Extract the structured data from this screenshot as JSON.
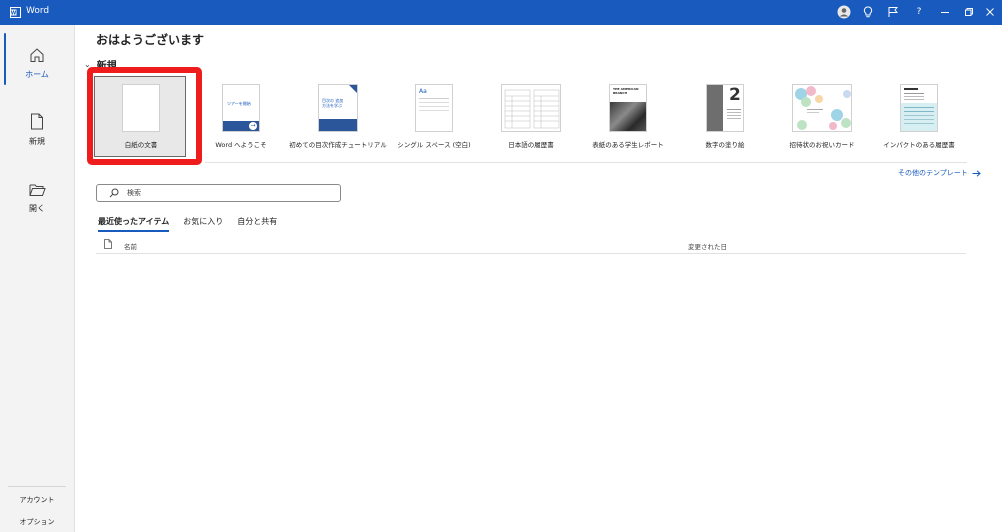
{
  "titlebar": {
    "app_name": "Word",
    "bg_color": "#185abd",
    "controls": [
      "avatar-icon",
      "lightbulb-icon",
      "feedback-icon",
      "help-icon",
      "minimize-icon",
      "restore-icon",
      "close-icon"
    ],
    "help_label": "?"
  },
  "sidebar": {
    "items": [
      {
        "label": "ホーム",
        "icon": "home-icon",
        "active": true
      },
      {
        "label": "新規",
        "icon": "new-document-icon",
        "active": false
      },
      {
        "label": "開く",
        "icon": "open-folder-icon",
        "active": false
      }
    ],
    "bottom": [
      {
        "label": "アカウント"
      },
      {
        "label": "オプション"
      }
    ]
  },
  "main": {
    "greeting": "おはようございます",
    "new_section_title": "新規",
    "templates": [
      {
        "label": "白紙の文書",
        "selected": true
      },
      {
        "label": "Word へようこそ",
        "thumb_text": "ツアーを開始"
      },
      {
        "label": "初めての目次作成チュートリアル",
        "thumb_text": "目次の 追加方法を学ぶ"
      },
      {
        "label": "シングル スペース (空白)",
        "thumb_text": "Aa"
      },
      {
        "label": "日本語の履歴書"
      },
      {
        "label": "表紙のある学生レポート",
        "thumb_text": "THE AMERICAN BRANCH"
      },
      {
        "label": "数字の塗り絵",
        "thumb_text": "2"
      },
      {
        "label": "招待状のお祝いカード"
      },
      {
        "label": "インパクトのある履歴書"
      }
    ],
    "more_templates": "その他のテンプレート",
    "search_placeholder": "検索",
    "doc_tabs": [
      "最近使ったアイテム",
      "お気に入り",
      "自分と共有"
    ],
    "list_columns": {
      "name": "名前",
      "modified": "変更された日"
    },
    "annotation_color": "#ee1c1c"
  }
}
